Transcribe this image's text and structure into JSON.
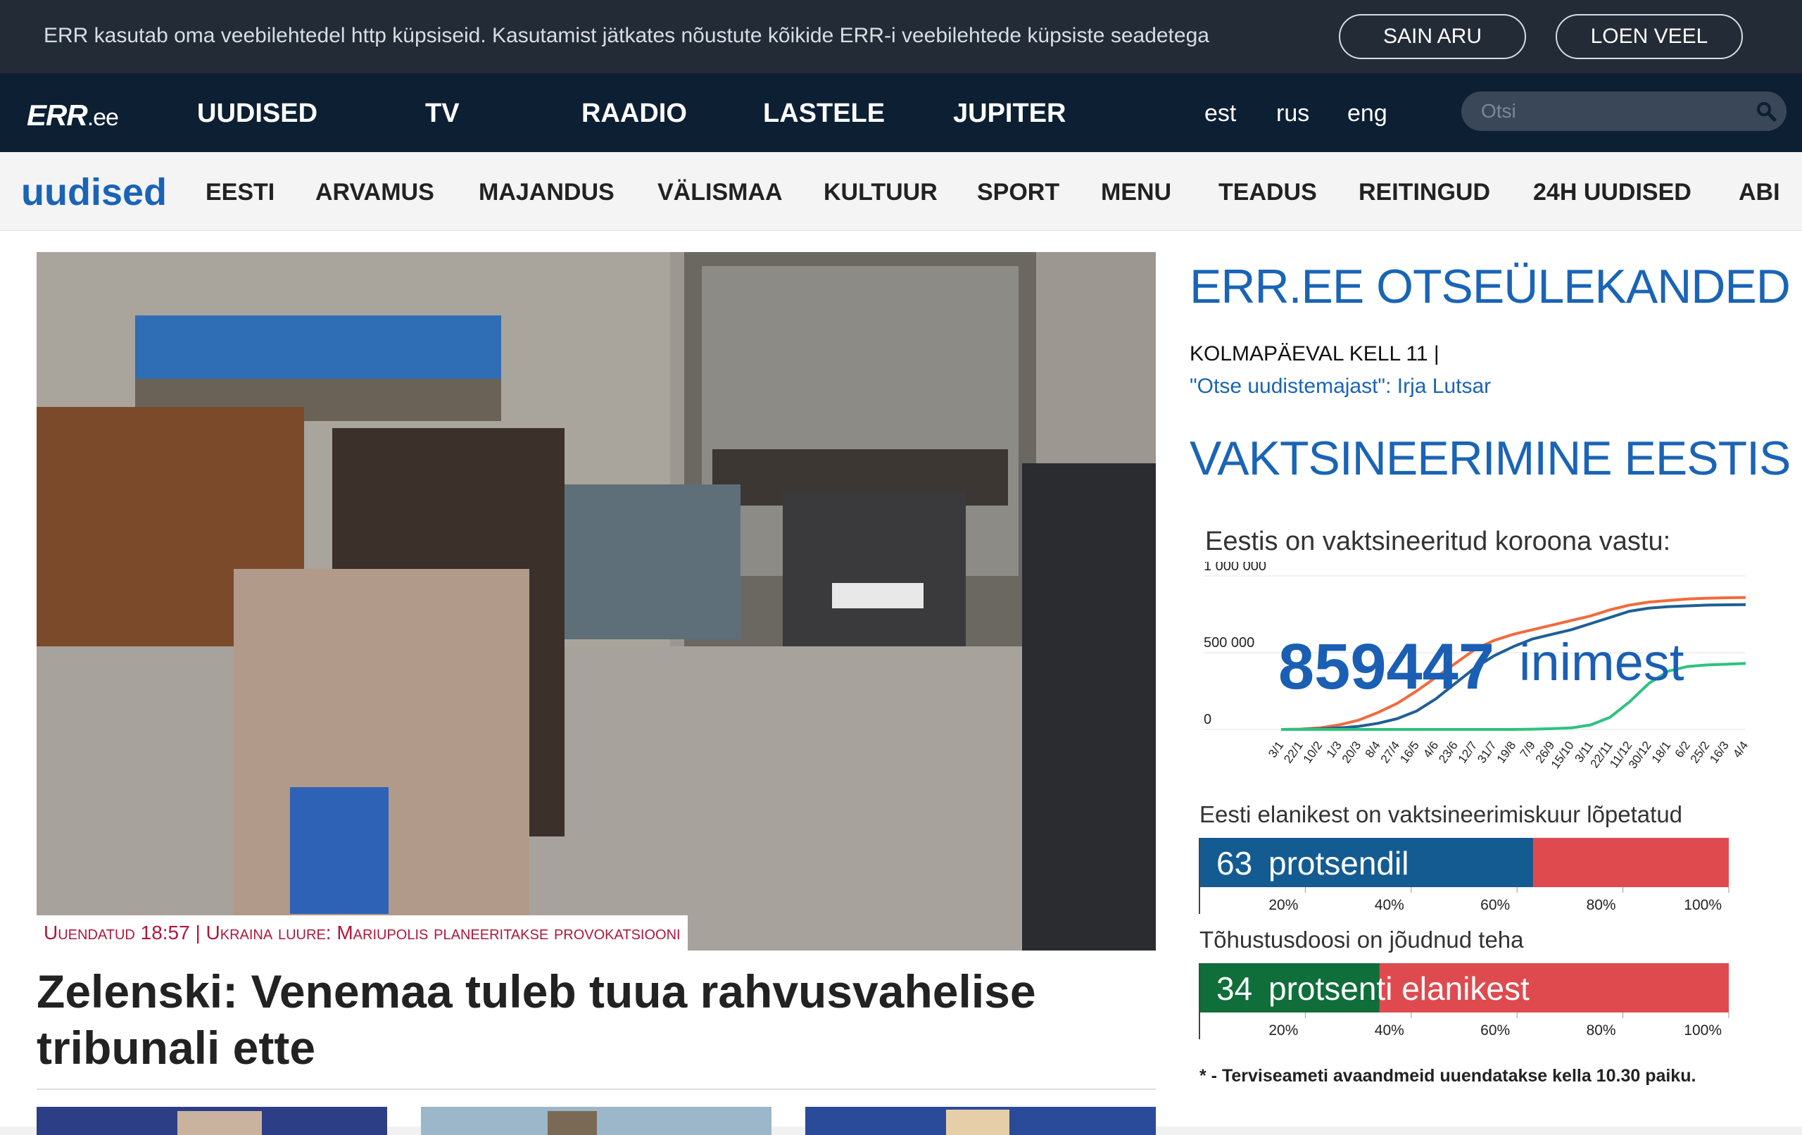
{
  "cookie": {
    "message": "ERR kasutab oma veebilehtedel http küpsiseid. Kasutamist jätkates nõustute kõikide ERR-i veebilehtede küpsiste seadetega",
    "agree_label": "SAIN ARU",
    "more_label": "LOEN VEEL"
  },
  "topnav": {
    "logo": "ERR",
    "logo_suffix": ".ee",
    "items": [
      "UUDISED",
      "TV",
      "RAADIO",
      "LASTELE",
      "JUPITER"
    ],
    "languages": [
      "est",
      "rus",
      "eng"
    ],
    "search_placeholder": "Otsi"
  },
  "subnav": {
    "brand": "uudised",
    "items": [
      "EESTI",
      "ARVAMUS",
      "MAJANDUS",
      "VÄLISMAA",
      "KULTUUR",
      "SPORT",
      "MENU",
      "TEADUS",
      "REITINGUD",
      "24H UUDISED",
      "ABI"
    ]
  },
  "hero": {
    "tag": "Uuendatud 18:57 | Ukraina luure: Mariupolis planeeritakse provokatsiooni",
    "headline": "Zelenski: Venemaa tuleb tuua rahvusvahelise tribunali ette"
  },
  "sidebar": {
    "live_heading": "ERR.EE OTSEÜLEKANDED",
    "live_when": "KOLMAPÄEVAL KELL 11 |",
    "live_link": "\"Otse uudistemajast\": Irja Lutsar",
    "vax_heading": "VAKTSINEERIMINE EESTIS",
    "widget_title": "Eestis on vaktsineeritud koroona vastu:",
    "vaccinated_count": "859447",
    "vaccinated_unit": "inimest",
    "completed_title": "Eesti elanikest on vaktsineerimiskuur lõpetatud",
    "completed_percent": 63,
    "completed_label": "protsendil",
    "booster_title": "Tõhustusdoosi on jõudnud teha",
    "booster_percent": 34,
    "booster_label": "protsenti elanikest",
    "bar_ticks": [
      "20%",
      "40%",
      "60%",
      "80%",
      "100%"
    ],
    "footnote": "* - Terviseameti avaandmeid uuendatakse kella 10.30 paiku.",
    "colors": {
      "completed": "#145b92",
      "booster": "#0f6e3a",
      "remaining": "#df4a4f"
    }
  },
  "chart_data": {
    "type": "line",
    "title": "Eestis on vaktsineeritud koroona vastu:",
    "x": [
      "3/1",
      "22/1",
      "10/2",
      "1/3",
      "20/3",
      "8/4",
      "27/4",
      "16/5",
      "4/6",
      "23/6",
      "12/7",
      "31/7",
      "19/8",
      "7/9",
      "26/9",
      "15/10",
      "3/11",
      "22/11",
      "11/12",
      "30/12",
      "18/1",
      "6/2",
      "25/2",
      "16/3",
      "4/4"
    ],
    "ylim": [
      0,
      1000000
    ],
    "yticks": [
      "0",
      "500 000",
      "1 000 000"
    ],
    "series": [
      {
        "color": "#f26a3b",
        "values": [
          0,
          2000,
          10000,
          30000,
          60000,
          110000,
          170000,
          250000,
          340000,
          430000,
          520000,
          580000,
          620000,
          650000,
          680000,
          710000,
          740000,
          780000,
          810000,
          830000,
          840000,
          850000,
          855000,
          858000,
          859447
        ]
      },
      {
        "color": "#1f5f95",
        "values": [
          0,
          500,
          3000,
          10000,
          20000,
          40000,
          70000,
          120000,
          200000,
          300000,
          400000,
          480000,
          540000,
          590000,
          620000,
          650000,
          690000,
          730000,
          770000,
          790000,
          800000,
          805000,
          810000,
          812000,
          813000
        ]
      },
      {
        "color": "#2ec27e",
        "values": [
          0,
          0,
          0,
          0,
          0,
          0,
          0,
          0,
          0,
          0,
          0,
          0,
          0,
          2000,
          5000,
          10000,
          30000,
          80000,
          180000,
          300000,
          380000,
          410000,
          420000,
          425000,
          430000
        ]
      }
    ]
  }
}
